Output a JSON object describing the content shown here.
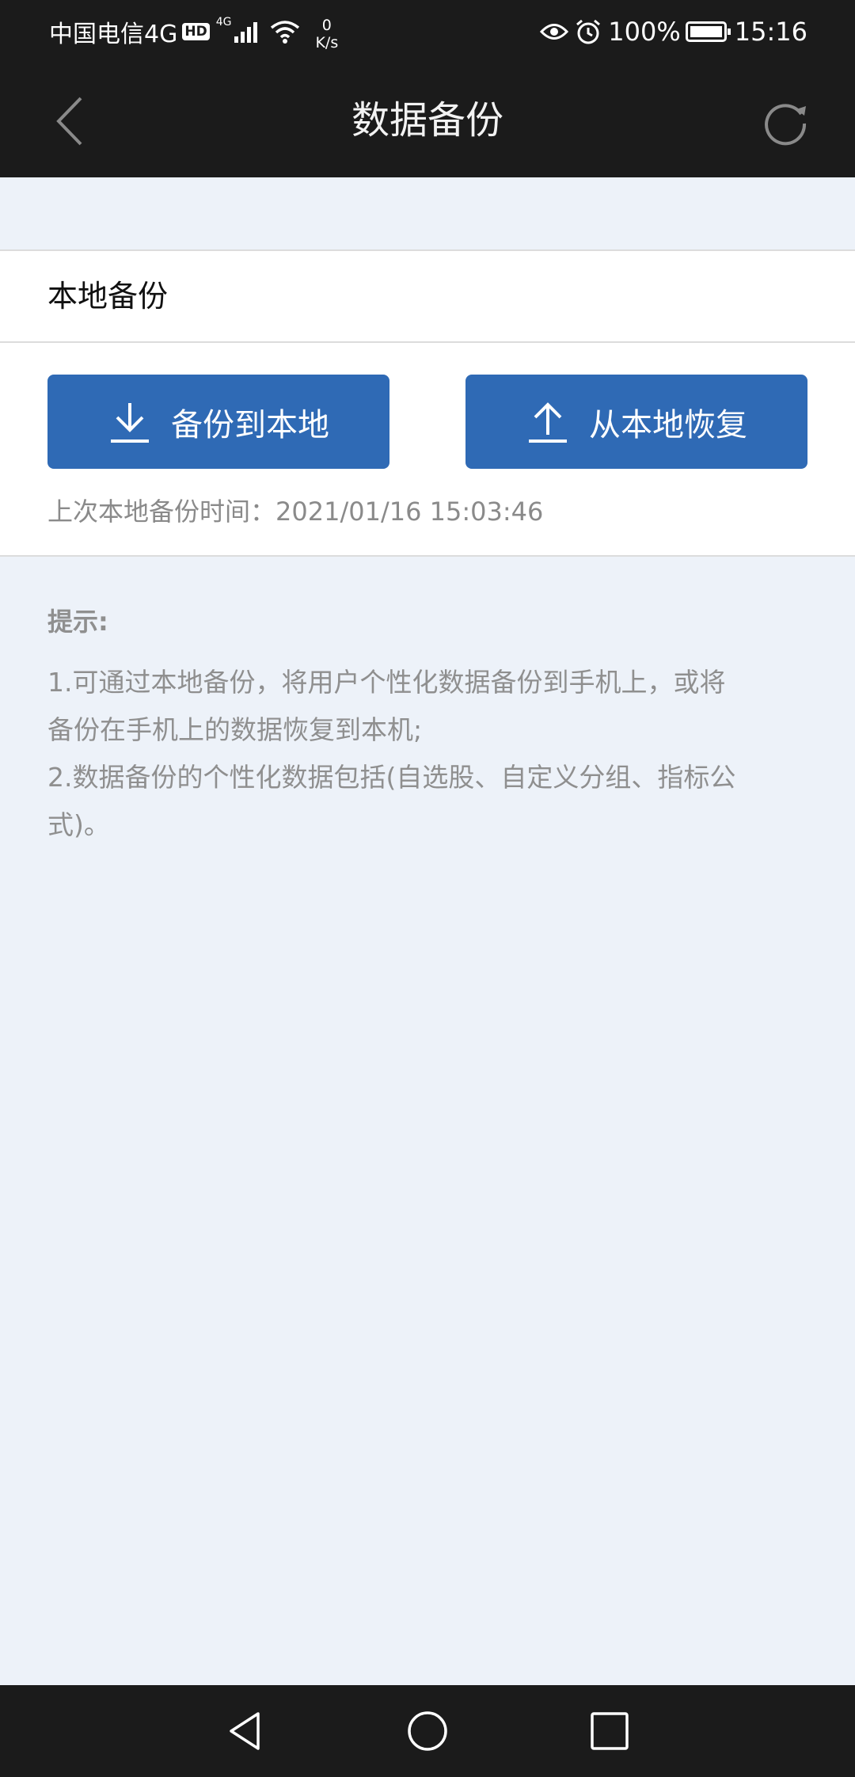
{
  "status_bar": {
    "carrier": "中国电信4G",
    "hd": "HD",
    "network": "4G",
    "speed_value": "0",
    "speed_unit": "K/s",
    "battery": "100%",
    "time": "15:16"
  },
  "nav": {
    "title": "数据备份"
  },
  "section": {
    "title": "本地备份"
  },
  "backup": {
    "backup_label": "备份到本地",
    "restore_label": "从本地恢复",
    "last_backup": "上次本地备份时间：2021/01/16 15:03:46"
  },
  "tips": {
    "title": "提示:",
    "lines": [
      "1.可通过本地备份，将用户个性化数据备份到手机上，或将",
      "备份在手机上的数据恢复到本机;",
      "2.数据备份的个性化数据包括(自选股、自定义分组、指标公",
      "式)。"
    ]
  },
  "colors": {
    "bar_bg": "#1b1b1b",
    "page_bg": "#edf2f9",
    "button_blue": "#2f6ab5",
    "hint_gray": "#8f8f8f"
  }
}
